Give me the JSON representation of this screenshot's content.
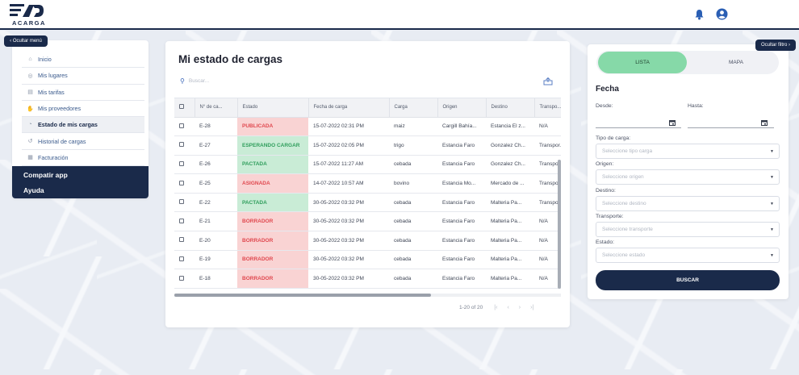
{
  "header": {
    "logo_text": "ACARGA",
    "bell_icon": "bell-icon",
    "user_icon": "user-circle-icon"
  },
  "sidebar": {
    "toggle_label": "‹ Ocultar menú",
    "items": [
      {
        "label": "Inicio",
        "icon": "home-icon"
      },
      {
        "label": "Mis lugares",
        "icon": "map-pin-icon"
      },
      {
        "label": "Mis tarifas",
        "icon": "document-icon"
      },
      {
        "label": "Mis proveedores",
        "icon": "handshake-icon"
      },
      {
        "label": "Estado de mis cargas",
        "icon": "package-icon"
      },
      {
        "label": "Historial de cargas",
        "icon": "history-icon"
      },
      {
        "label": "Facturación",
        "icon": "invoice-icon"
      }
    ],
    "share_label": "Compatir app",
    "help_label": "Ayuda"
  },
  "main": {
    "title": "Mi estado de cargas",
    "search_placeholder": "Buscar...",
    "columns": [
      "N° de ca...",
      "Estado",
      "Fecha de carga",
      "Carga",
      "Origen",
      "Destino",
      "Transpo..."
    ],
    "rows": [
      {
        "id": "E-28",
        "estado": "PUBLICADA",
        "fecha": "15-07-2022 02:31 PM",
        "carga": "maiz",
        "origen": "Cargill Bahía...",
        "destino": "Estancia El z...",
        "transporte": "N/A"
      },
      {
        "id": "E-27",
        "estado": "ESPERANDO CARGAR",
        "fecha": "15-07-2022 02:05 PM",
        "carga": "trigo",
        "origen": "Estancia Faro",
        "destino": "Gonzalez Ch...",
        "transporte": "Transpor..."
      },
      {
        "id": "E-26",
        "estado": "PACTADA",
        "fecha": "15-07-2022 11:27 AM",
        "carga": "cebada",
        "origen": "Estancia Faro",
        "destino": "Gonzalez Ch...",
        "transporte": "Transpo..."
      },
      {
        "id": "E-25",
        "estado": "ASIGNADA",
        "fecha": "14-07-2022 10:57 AM",
        "carga": "bovino",
        "origen": "Estancia Mo...",
        "destino": "Mercado de ...",
        "transporte": "Transpo..."
      },
      {
        "id": "E-22",
        "estado": "PACTADA",
        "fecha": "30-05-2022 03:32 PM",
        "carga": "cebada",
        "origen": "Estancia Faro",
        "destino": "Malteria Pa...",
        "transporte": "Transpo..."
      },
      {
        "id": "E-21",
        "estado": "BORRADOR",
        "fecha": "30-05-2022 03:32 PM",
        "carga": "cebada",
        "origen": "Estancia Faro",
        "destino": "Malteria Pa...",
        "transporte": "N/A"
      },
      {
        "id": "E-20",
        "estado": "BORRADOR",
        "fecha": "30-05-2022 03:32 PM",
        "carga": "cebada",
        "origen": "Estancia Faro",
        "destino": "Malteria Pa...",
        "transporte": "N/A"
      },
      {
        "id": "E-19",
        "estado": "BORRADOR",
        "fecha": "30-05-2022 03:32 PM",
        "carga": "cebada",
        "origen": "Estancia Faro",
        "destino": "Malteria Pa...",
        "transporte": "N/A"
      },
      {
        "id": "E-18",
        "estado": "BORRADOR",
        "fecha": "30-05-2022 03:32 PM",
        "carga": "cebada",
        "origen": "Estancia Faro",
        "destino": "Malteria Pa...",
        "transporte": "N/A"
      }
    ],
    "pagination_text": "1-20 of 20"
  },
  "filter": {
    "toggle_label": "Ocultar filtro ›",
    "tab_list": "LISTA",
    "tab_map": "MAPA",
    "title": "Fecha",
    "from_label": "Desde:",
    "to_label": "Hasta:",
    "tipo_label": "Tipo de carga:",
    "tipo_placeholder": "Seleccione tipo carga",
    "origen_label": "Origen:",
    "origen_placeholder": "Seleccione origen",
    "destino_label": "Destino:",
    "destino_placeholder": "Seleccione destino",
    "transporte_label": "Transporte:",
    "transporte_placeholder": "Seleccione transporte",
    "estado_label": "Estado:",
    "estado_placeholder": "Seleccione estado",
    "search_button": "BUSCAR"
  },
  "colors": {
    "navy": "#1a2a4a",
    "status_red_bg": "#f9d3d3",
    "status_red_text": "#e0484f",
    "status_green_bg": "#c9ecd6",
    "status_green_text": "#2f9e5c",
    "toggle_green": "#86d9a8"
  }
}
